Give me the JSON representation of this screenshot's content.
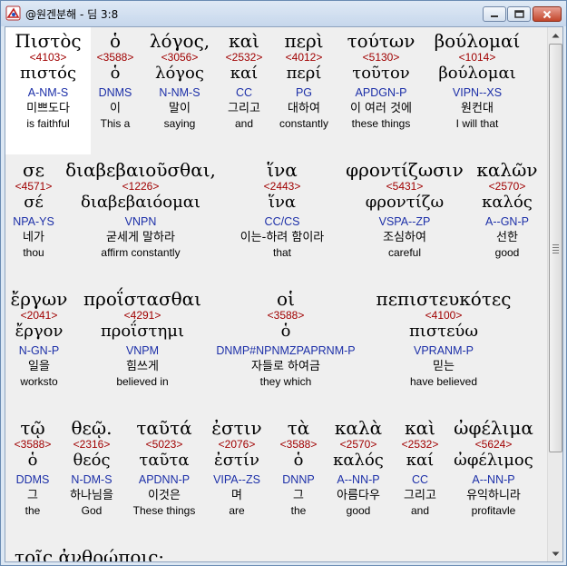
{
  "window": {
    "title": "@원겐분해 - 딤 3:8"
  },
  "words": [
    {
      "greek": "Πιστὸς",
      "strong": "<4103>",
      "lemma": "πιστός",
      "parse": "A-NM-S",
      "korean": "미쁘도다",
      "english": "is faithful"
    },
    {
      "greek": "ὁ",
      "strong": "<3588>",
      "lemma": "ὁ",
      "parse": "DNMS",
      "korean": "이",
      "english": "This a"
    },
    {
      "greek": "λόγος,",
      "strong": "<3056>",
      "lemma": "λόγος",
      "parse": "N-NM-S",
      "korean": "말이",
      "english": "saying"
    },
    {
      "greek": "καὶ",
      "strong": "<2532>",
      "lemma": "καί",
      "parse": "CC",
      "korean": "그리고",
      "english": "and"
    },
    {
      "greek": "περὶ",
      "strong": "<4012>",
      "lemma": "περί",
      "parse": "PG",
      "korean": "대하여",
      "english": "constantly"
    },
    {
      "greek": "τούτων",
      "strong": "<5130>",
      "lemma": "τοῦτον",
      "parse": "APDGN-P",
      "korean": "이 여러 것에",
      "english": "these things"
    },
    {
      "greek": "βούλομαί",
      "strong": "<1014>",
      "lemma": "βούλομαι",
      "parse": "VIPN--XS",
      "korean": "원컨대",
      "english": "I will that"
    },
    {
      "greek": "σε",
      "strong": "<4571>",
      "lemma": "σέ",
      "parse": "NPA-YS",
      "korean": "네가",
      "english": "thou"
    },
    {
      "greek": "διαβεβαιοῦσθαι,",
      "strong": "<1226>",
      "lemma": "διαβεβαιόομαι",
      "parse": "VNPN",
      "korean": "굳세게 말하라",
      "english": "affirm constantly"
    },
    {
      "greek": "ἵνα",
      "strong": "<2443>",
      "lemma": "ἵνα",
      "parse": "CC/CS",
      "korean": "이는-하려 함이라",
      "english": "that"
    },
    {
      "greek": "φροντίζωσιν",
      "strong": "<5431>",
      "lemma": "φροντίζω",
      "parse": "VSPA--ZP",
      "korean": "조심하여",
      "english": "careful"
    },
    {
      "greek": "καλῶν",
      "strong": "<2570>",
      "lemma": "καλός",
      "parse": "A--GN-P",
      "korean": "선한",
      "english": "good"
    },
    {
      "greek": "ἔργων",
      "strong": "<2041>",
      "lemma": "ἔργον",
      "parse": "N-GN-P",
      "korean": "일을",
      "english": "worksto"
    },
    {
      "greek": "προΐστασθαι",
      "strong": "<4291>",
      "lemma": "προΐστημι",
      "parse": "VNPM",
      "korean": "힘쓰게",
      "english": "believed in"
    },
    {
      "greek": "οἱ",
      "strong": "<3588>",
      "lemma": "ὁ",
      "parse": "DNMP#NPNMZPAPRNM-P",
      "korean": "자들로 하여금",
      "english": "they which"
    },
    {
      "greek": "πεπιστευκότες",
      "strong": "<4100>",
      "lemma": "πιστεύω",
      "parse": "VPRANM-P",
      "korean": "믿는",
      "english": "have believed"
    },
    {
      "greek": "τῷ",
      "strong": "<3588>",
      "lemma": "ὁ",
      "parse": "DDMS",
      "korean": "그",
      "english": "the"
    },
    {
      "greek": "θεῷ.",
      "strong": "<2316>",
      "lemma": "θεός",
      "parse": "N-DM-S",
      "korean": "하나님을",
      "english": "God"
    },
    {
      "greek": "ταῦτά",
      "strong": "<5023>",
      "lemma": "ταῦτα",
      "parse": "APDNN-P",
      "korean": "이것은",
      "english": "These things"
    },
    {
      "greek": "ἐστιν",
      "strong": "<2076>",
      "lemma": "ἐστίν",
      "parse": "VIPA--ZS",
      "korean": "며",
      "english": "are"
    },
    {
      "greek": "τὰ",
      "strong": "<3588>",
      "lemma": "ὁ",
      "parse": "DNNP",
      "korean": "그",
      "english": "the"
    },
    {
      "greek": "καλὰ",
      "strong": "<2570>",
      "lemma": "καλός",
      "parse": "A--NN-P",
      "korean": "아름다우",
      "english": "good"
    },
    {
      "greek": "καὶ",
      "strong": "<2532>",
      "lemma": "καί",
      "parse": "CC",
      "korean": "그리고",
      "english": "and"
    },
    {
      "greek": "ὠφέλιμα",
      "strong": "<5624>",
      "lemma": "ὠφέλιμος",
      "parse": "A--NN-P",
      "korean": "유익하니라",
      "english": "profitavle"
    }
  ],
  "partial_line": "τοῖς ἀνθρώποις·"
}
